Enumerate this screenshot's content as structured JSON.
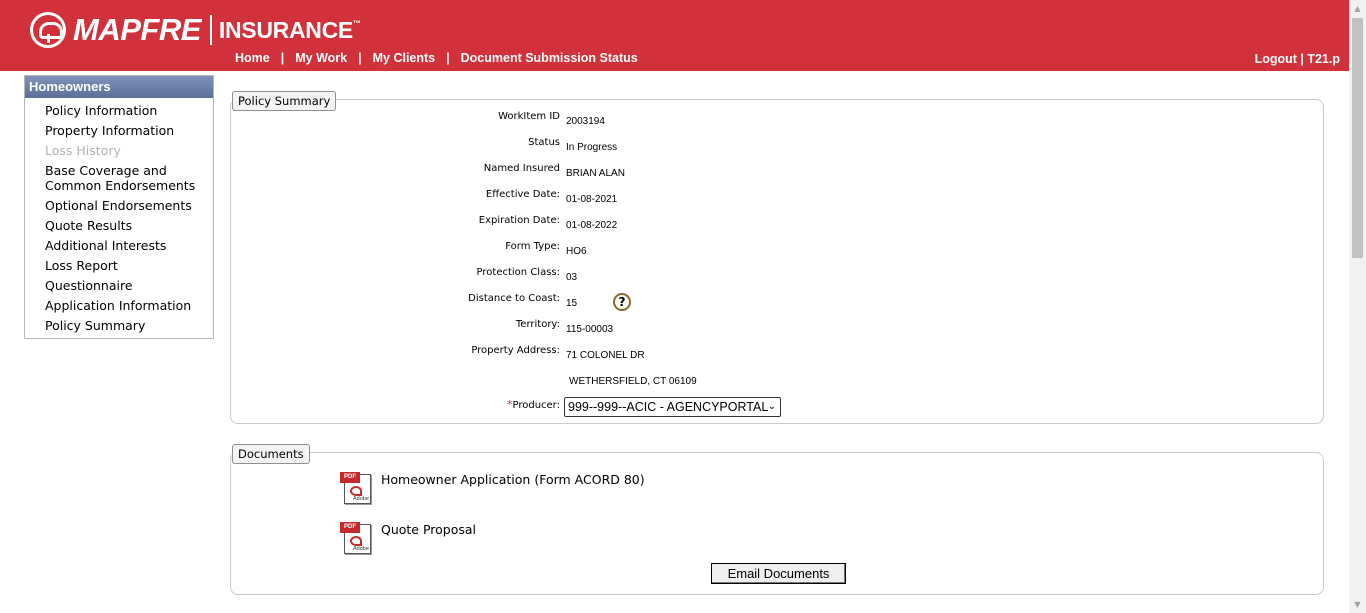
{
  "header": {
    "brand": "MAPFRE",
    "brand_suffix": "INSURANCE",
    "trademark": "™",
    "nav": [
      "Home",
      "My Work",
      "My Clients",
      "Document Submission Status"
    ],
    "nav_separator": "|",
    "logout": "Logout | T21.p",
    "bg_color": "#d0313a"
  },
  "sidebar": {
    "title": "Homeowners",
    "items": [
      {
        "label": "Policy Information",
        "enabled": true
      },
      {
        "label": "Property Information",
        "enabled": true
      },
      {
        "label": "Loss History",
        "enabled": false
      },
      {
        "label": "Base Coverage and Common Endorsements",
        "enabled": true
      },
      {
        "label": "Optional Endorsements",
        "enabled": true
      },
      {
        "label": "Quote Results",
        "enabled": true
      },
      {
        "label": "Additional Interests",
        "enabled": true
      },
      {
        "label": "Loss Report",
        "enabled": true
      },
      {
        "label": "Questionnaire",
        "enabled": true
      },
      {
        "label": "Application Information",
        "enabled": true
      },
      {
        "label": "Policy Summary",
        "enabled": true
      }
    ]
  },
  "summary": {
    "legend": "Policy Summary",
    "fields": [
      {
        "label": "WorkItem ID",
        "value": "2003194"
      },
      {
        "label": "Status",
        "value": "In Progress"
      },
      {
        "label": "Named Insured",
        "value": "BRIAN ALAN"
      },
      {
        "label": "Effective Date:",
        "value": "01-08-2021"
      },
      {
        "label": "Expiration Date:",
        "value": "01-08-2022"
      },
      {
        "label": "Form Type:",
        "value": "HO6"
      },
      {
        "label": "Protection Class:",
        "value": "03"
      },
      {
        "label": "Distance to Coast:",
        "value": "15"
      },
      {
        "label": "Territory:",
        "value": "115-00003"
      },
      {
        "label": "Property Address:",
        "value": "71 COLONEL DR"
      }
    ],
    "address_line2": "WETHERSFIELD, CT 06109",
    "help_icon": "question-icon",
    "help_glyph": "?",
    "producer_required_mark": "*",
    "producer_label": "Producer:",
    "producer_selected": "999--999--ACIC - AGENCYPORTAL",
    "producer_chevron": "⌄"
  },
  "documents": {
    "legend": "Documents",
    "items": [
      {
        "label": "Homeowner Application (Form ACORD 80)",
        "icon": "pdf-icon"
      },
      {
        "label": "Quote Proposal",
        "icon": "pdf-icon"
      }
    ],
    "pdf_tag": "PDF",
    "pdf_brand": "Adobe",
    "email_button": "Email Documents"
  },
  "scrollbar": {
    "up_glyph": "▲",
    "down_glyph": "▼"
  }
}
